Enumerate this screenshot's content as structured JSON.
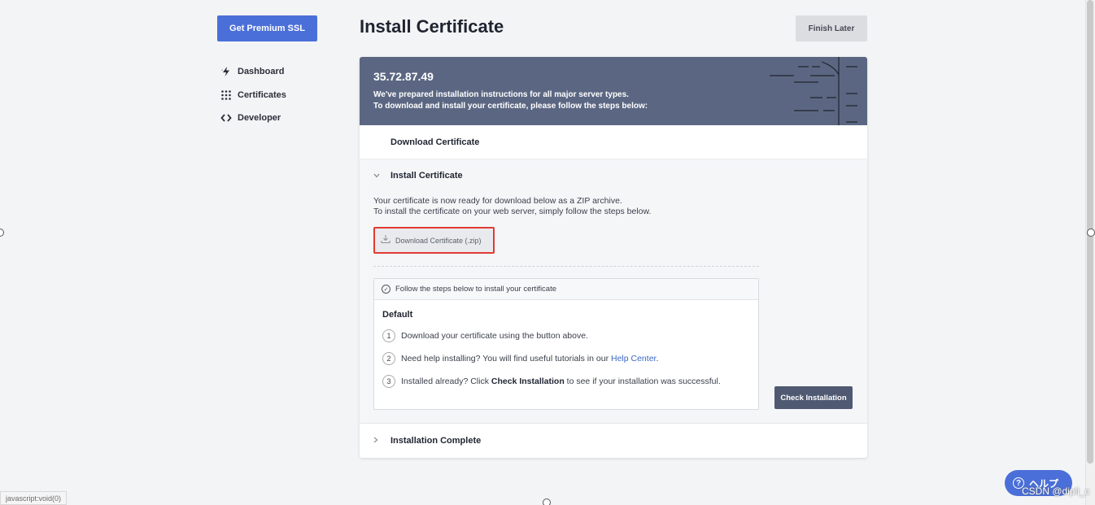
{
  "sidebar": {
    "premium_button": "Get Premium SSL",
    "items": [
      {
        "label": "Dashboard",
        "icon": "lightning-icon"
      },
      {
        "label": "Certificates",
        "icon": "grid-icon"
      },
      {
        "label": "Developer",
        "icon": "code-icon"
      }
    ]
  },
  "header": {
    "title": "Install Certificate",
    "finish_later": "Finish Later"
  },
  "banner": {
    "ip": "35.72.87.49",
    "line1": "We've prepared installation instructions for all major server types.",
    "line2": "To download and install your certificate, please follow the steps below:"
  },
  "steps": {
    "download_certificate": "Download Certificate",
    "install_certificate": "Install Certificate",
    "install_text_line1": "Your certificate is now ready for download below as a ZIP archive.",
    "install_text_line2": "To install the certificate on your web server, simply follow the steps below.",
    "download_zip_button": "Download Certificate (.zip)",
    "follow_steps_head": "Follow the steps below to install your certificate",
    "default_label": "Default",
    "step1": "Download your certificate using the button above.",
    "step2_pre": "Need help installing? You will find useful tutorials in our ",
    "step2_link": "Help Center",
    "step2_post": ".",
    "step3_pre": "Installed already? Click ",
    "step3_bold": "Check Installation",
    "step3_post": " to see if your installation was successful.",
    "check_installation_button": "Check Installation",
    "installation_complete": "Installation Complete"
  },
  "footer": {
    "status_url": "javascript:void(0)",
    "help_label": "ヘルプ",
    "watermark": "CSDN @dipli_c"
  },
  "colors": {
    "accent": "#4a6fd8",
    "banner": "#5b6782",
    "highlight": "#e23a32"
  }
}
